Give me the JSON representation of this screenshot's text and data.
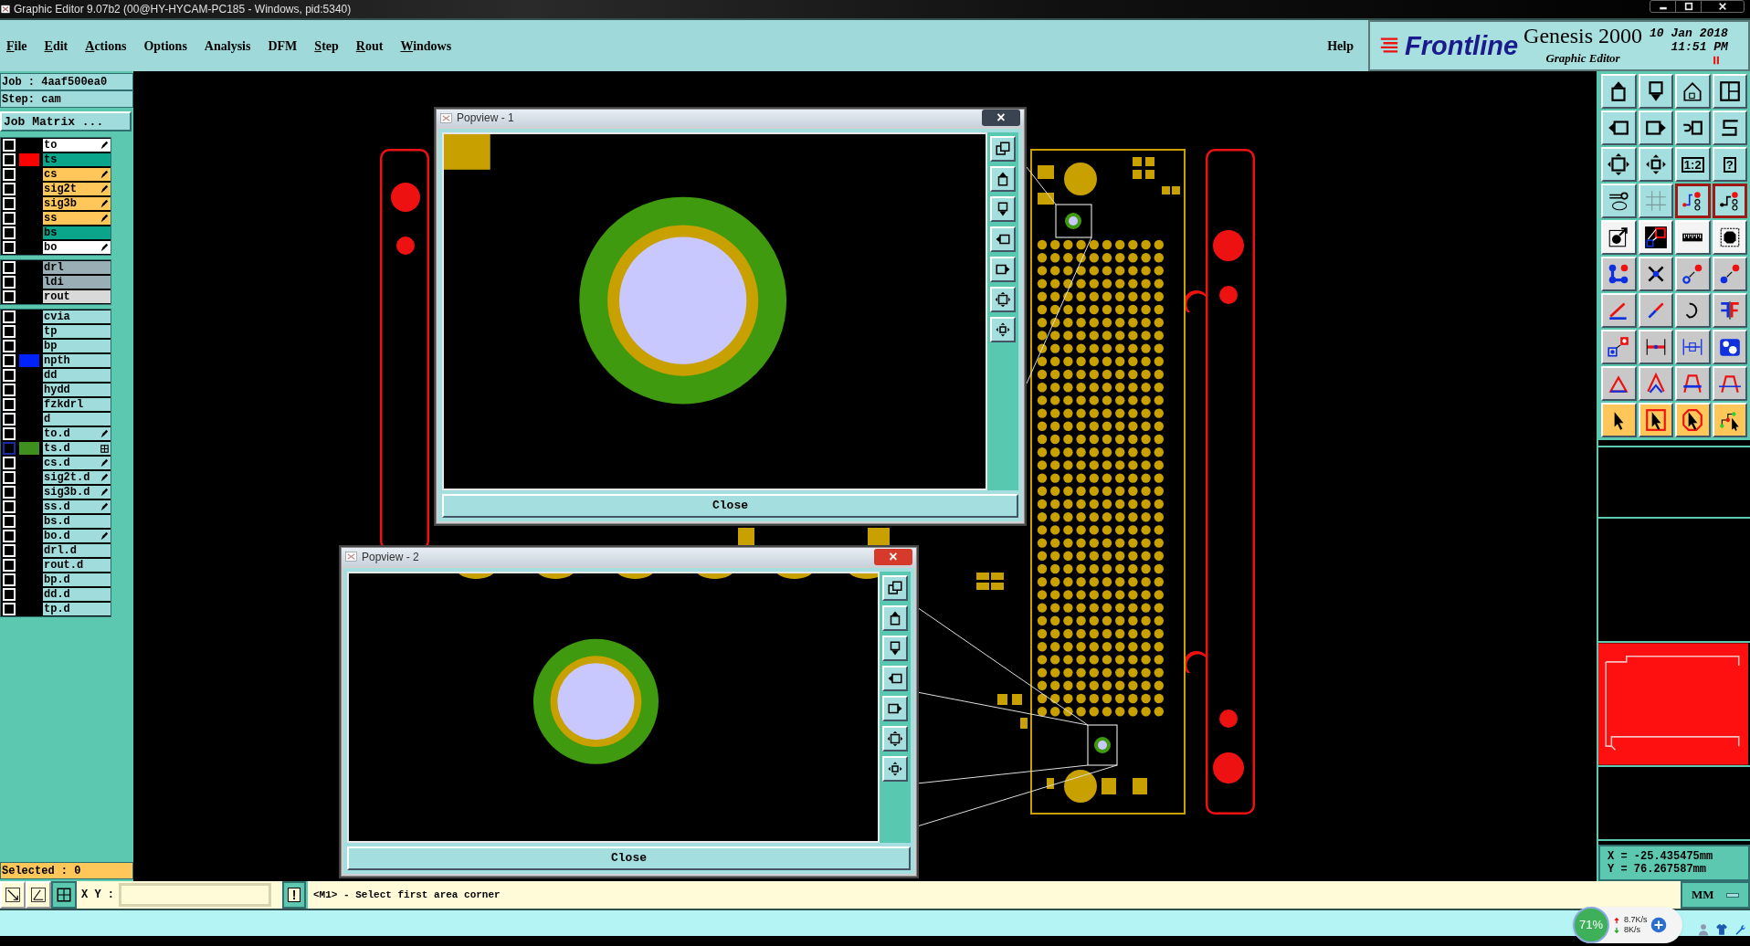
{
  "title_bar": {
    "title": "Graphic Editor 9.07b2 (00@HY-HYCAM-PC185 - Windows, pid:5340)"
  },
  "menu": [
    {
      "label": "File",
      "mnemonic": true
    },
    {
      "label": "Edit",
      "mnemonic": true
    },
    {
      "label": "Actions",
      "mnemonic": true
    },
    {
      "label": "Options",
      "mnemonic": false
    },
    {
      "label": "Analysis",
      "mnemonic": false
    },
    {
      "label": "DFM",
      "mnemonic": false
    },
    {
      "label": "Step",
      "mnemonic": true
    },
    {
      "label": "Rout",
      "mnemonic": true
    },
    {
      "label": "Windows",
      "mnemonic": true
    }
  ],
  "help": "Help",
  "brand": {
    "logo": "Frontline",
    "product": "Genesis 2000",
    "subtitle": "Graphic Editor",
    "date": "10 Jan 2018",
    "time": "11:51 PM"
  },
  "job": {
    "job": "Job : 4aaf500ea0",
    "step": "Step: cam",
    "matrix_button": "Job Matrix ..."
  },
  "layer_groups": [
    [
      {
        "name": "to",
        "kind": "silk",
        "checked": false,
        "focused": false,
        "edit": true
      },
      {
        "name": "ts",
        "kind": "mask",
        "checked": false,
        "focused": false,
        "edit": false,
        "color": "#ff0000"
      },
      {
        "name": "cs",
        "kind": "signal",
        "checked": false,
        "focused": false,
        "edit": true
      },
      {
        "name": "sig2t",
        "kind": "signal",
        "checked": false,
        "focused": false,
        "edit": true
      },
      {
        "name": "sig3b",
        "kind": "signal",
        "checked": false,
        "focused": false,
        "edit": true
      },
      {
        "name": "ss",
        "kind": "signal",
        "checked": false,
        "focused": false,
        "edit": true
      },
      {
        "name": "bs",
        "kind": "mask",
        "checked": false,
        "focused": false,
        "edit": false
      },
      {
        "name": "bo",
        "kind": "silk",
        "checked": false,
        "focused": false,
        "edit": true
      }
    ],
    [
      {
        "name": "drl",
        "kind": "drill",
        "checked": false,
        "focused": false,
        "edit": false
      },
      {
        "name": "ldi",
        "kind": "drill",
        "checked": false,
        "focused": false,
        "edit": false
      },
      {
        "name": "rout",
        "kind": "rout",
        "checked": false,
        "focused": false,
        "edit": false
      }
    ],
    [
      {
        "name": "cvia",
        "kind": "misc",
        "checked": false,
        "focused": false,
        "edit": false
      },
      {
        "name": "tp",
        "kind": "misc",
        "checked": false,
        "focused": false,
        "edit": false
      },
      {
        "name": "bp",
        "kind": "misc",
        "checked": false,
        "focused": false,
        "edit": false
      },
      {
        "name": "npth",
        "kind": "misc",
        "checked": false,
        "focused": false,
        "edit": false,
        "color": "#0022ff"
      },
      {
        "name": "dd",
        "kind": "misc",
        "checked": false,
        "focused": false,
        "edit": false
      },
      {
        "name": "hydd",
        "kind": "misc",
        "checked": false,
        "focused": false,
        "edit": false
      },
      {
        "name": "fzkdrl",
        "kind": "misc",
        "checked": false,
        "focused": false,
        "edit": false
      },
      {
        "name": "d",
        "kind": "misc",
        "checked": false,
        "focused": false,
        "edit": false
      },
      {
        "name": "to.d",
        "kind": "misc",
        "checked": false,
        "focused": false,
        "edit": true
      },
      {
        "name": "ts.d",
        "kind": "misc",
        "checked": false,
        "focused": true,
        "edit": false,
        "grid": true,
        "color": "#3f8f1f"
      },
      {
        "name": "cs.d",
        "kind": "misc",
        "checked": false,
        "focused": false,
        "edit": true
      },
      {
        "name": "sig2t.d",
        "kind": "misc",
        "checked": false,
        "focused": false,
        "edit": true
      },
      {
        "name": "sig3b.d",
        "kind": "misc",
        "checked": false,
        "focused": false,
        "edit": true
      },
      {
        "name": "ss.d",
        "kind": "misc",
        "checked": false,
        "focused": false,
        "edit": true
      },
      {
        "name": "bs.d",
        "kind": "misc",
        "checked": false,
        "focused": false,
        "edit": false
      },
      {
        "name": "bo.d",
        "kind": "misc",
        "checked": false,
        "focused": false,
        "edit": true
      },
      {
        "name": "drl.d",
        "kind": "misc",
        "checked": false,
        "focused": false,
        "edit": false
      },
      {
        "name": "rout.d",
        "kind": "misc",
        "checked": false,
        "focused": false,
        "edit": false
      },
      {
        "name": "bp.d",
        "kind": "misc",
        "checked": false,
        "focused": false,
        "edit": false
      },
      {
        "name": "dd.d",
        "kind": "misc",
        "checked": false,
        "focused": false,
        "edit": false
      },
      {
        "name": "tp.d",
        "kind": "misc",
        "checked": false,
        "focused": false,
        "edit": false
      }
    ]
  ],
  "selected": "Selected : 0",
  "popviews": [
    {
      "title": "Popview - 1",
      "close_x": "×",
      "close_hover": false,
      "close": "Close"
    },
    {
      "title": "Popview - 2",
      "close_x": "×",
      "close_hover": true,
      "close": "Close"
    }
  ],
  "toolbar": [
    {
      "kind": "view",
      "on": false
    },
    {
      "kind": "view",
      "on": false
    },
    {
      "kind": "view",
      "on": false
    },
    {
      "kind": "view",
      "on": false
    },
    {
      "kind": "view",
      "on": false
    },
    {
      "kind": "view",
      "on": false
    },
    {
      "kind": "view",
      "on": false
    },
    {
      "kind": "view",
      "on": false
    },
    {
      "kind": "view",
      "on": false
    },
    {
      "kind": "view",
      "on": false
    },
    {
      "kind": "view",
      "on": false,
      "label": "1:2"
    },
    {
      "kind": "view",
      "on": false,
      "label": "?"
    },
    {
      "kind": "view",
      "on": false
    },
    {
      "kind": "view",
      "on": false
    },
    {
      "kind": "view",
      "on": true
    },
    {
      "kind": "view",
      "on": true
    },
    {
      "kind": "tool",
      "on": false
    },
    {
      "kind": "tool",
      "on": false
    },
    {
      "kind": "tool",
      "on": false
    },
    {
      "kind": "tool",
      "on": false
    },
    {
      "kind": "edit",
      "on": false
    },
    {
      "kind": "edit",
      "on": false
    },
    {
      "kind": "edit",
      "on": false
    },
    {
      "kind": "edit",
      "on": false
    },
    {
      "kind": "edit",
      "on": false
    },
    {
      "kind": "edit",
      "on": false
    },
    {
      "kind": "edit",
      "on": false
    },
    {
      "kind": "edit",
      "on": false
    },
    {
      "kind": "edit",
      "on": false
    },
    {
      "kind": "edit",
      "on": false
    },
    {
      "kind": "edit",
      "on": false
    },
    {
      "kind": "edit",
      "on": false
    },
    {
      "kind": "edit",
      "on": false
    },
    {
      "kind": "edit",
      "on": false
    },
    {
      "kind": "edit",
      "on": false
    },
    {
      "kind": "edit",
      "on": false
    },
    {
      "kind": "select",
      "on": false
    },
    {
      "kind": "select",
      "on": false
    },
    {
      "kind": "select",
      "on": false
    },
    {
      "kind": "select",
      "on": false
    }
  ],
  "coords": {
    "x": "X = -25.435475mm",
    "y": "Y = 76.267587mm"
  },
  "units": "MM",
  "xy_label": "X Y :",
  "confirm": "!",
  "prompt": "<M1> - Select first area corner",
  "net_monitor": {
    "percent": "71%",
    "up": "8.7K/s",
    "down": "8K/s"
  }
}
